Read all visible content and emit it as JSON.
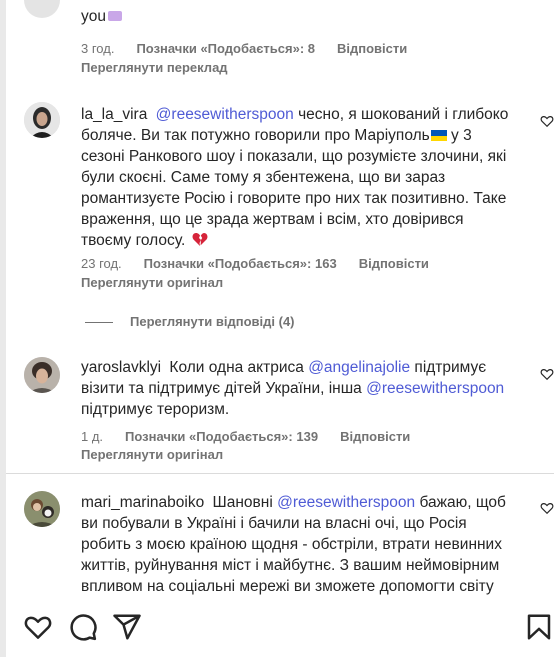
{
  "top_partial": {
    "tail_text": "you",
    "time": "3 год.",
    "likes": "Позначки «Подобається»: 8",
    "reply": "Відповісти",
    "translate": "Переглянути переклад"
  },
  "comments": [
    {
      "username": "la_la_vira",
      "mention": "@reesewitherspoon",
      "text_a": "чесно, я шокований і глибоко боляче. Ви так потужно говорили про Маріуполь",
      "text_b": "у 3 сезоні Ранкового шоу і показали, що розумієте злочини, які були скоєні. Саме тому я збентежена, що ви зараз романтизуєте Росію і говорите про них так позитивно. Таке враження, що це зрада жертвам і всім, хто довірився твоєму голосу.",
      "time": "23 год.",
      "likes": "Позначки «Подобається»: 163",
      "reply": "Відповісти",
      "see_original": "Переглянути оригінал",
      "view_replies": "Переглянути відповіді (4)"
    },
    {
      "username": "yaroslavklyi",
      "text_a": "Коли одна актриса",
      "mention_a": "@angelinajolie",
      "text_b": "підтримує візити та підтримує дітей України, інша",
      "mention_b": "@reesewitherspoon",
      "text_c": "підтримує тероризм.",
      "time": "1 д.",
      "likes": "Позначки «Подобається»: 139",
      "reply": "Відповісти",
      "see_original": "Переглянути оригінал"
    },
    {
      "username": "mari_marinaboiko",
      "text_a": "Шановні",
      "mention": "@reesewitherspoon",
      "text_b": "бажаю, щоб ви побували в Україні і бачили на власні очі, що Росія робить з моєю країною щодня - обстріли, втрати невинних життів, руйнування міст і майбутнє. З вашим неймовірним впливом на соціальні мережі ви зможете допомогти світу"
    }
  ],
  "colors": {
    "mention": "#4f5bd5",
    "meta": "#737373",
    "text": "#262626"
  },
  "icons": [
    "heart-icon",
    "comment-icon",
    "share-icon",
    "bookmark-icon",
    "broken-heart-emoji",
    "ukraine-flag-emoji"
  ]
}
